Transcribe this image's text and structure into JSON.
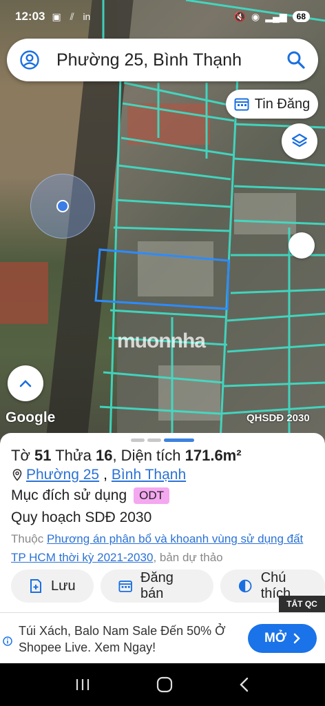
{
  "status_bar": {
    "time": "12:03",
    "battery": "68"
  },
  "search": {
    "value": "Phường 25, Bình Thạnh"
  },
  "map": {
    "tin_dang_label": "Tin Đăng",
    "watermark": "muonnha",
    "google_logo": "Google",
    "layer_label": "QHSDĐ 2030"
  },
  "sheet": {
    "to_label": "Tờ",
    "to_value": "51",
    "thua_label": "Thửa",
    "thua_value": "16",
    "area_label": ", Diện tích",
    "area_value": "171.6m²",
    "ward_link": "Phường 25",
    "district_link": "Bình Thạnh",
    "purpose_label": "Mục đích sử dụng",
    "purpose_badge": "ODT",
    "planning_label": "Quy hoạch SDĐ 2030",
    "belongs_prefix": "Thuộc",
    "plan_link": "Phương án phân bổ và khoanh vùng sử dụng đất TP HCM thời kỳ 2021-2030",
    "belongs_suffix": ", bản dự thảo",
    "actions": {
      "save": "Lưu",
      "sell": "Đăng bán",
      "legend": "Chú thích"
    }
  },
  "ad": {
    "close_label": "TẮT QC",
    "text": "Túi Xách, Balo Nam Sale Đến 50% Ở Shopee Live. Xem Ngay!",
    "cta": "MỞ"
  },
  "colors": {
    "accent": "#1a73e8",
    "parcel_line": "#3ee0c8",
    "selected_parcel": "#2b8cff",
    "badge": "#f4a8f0"
  }
}
